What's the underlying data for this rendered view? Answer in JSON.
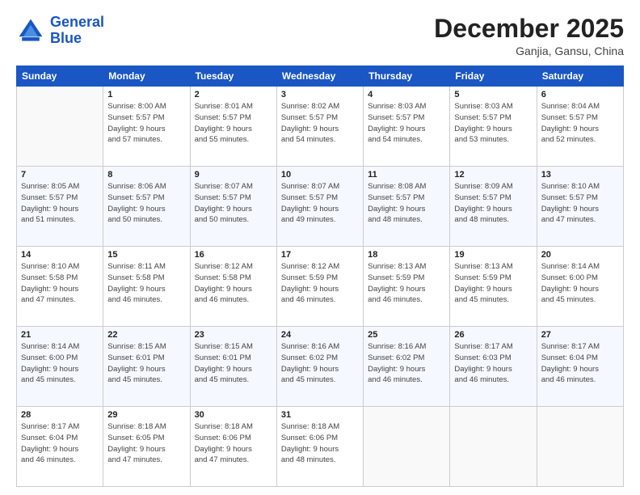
{
  "header": {
    "logo_line1": "General",
    "logo_line2": "Blue",
    "month_title": "December 2025",
    "subtitle": "Ganjia, Gansu, China"
  },
  "days_of_week": [
    "Sunday",
    "Monday",
    "Tuesday",
    "Wednesday",
    "Thursday",
    "Friday",
    "Saturday"
  ],
  "weeks": [
    [
      {
        "day": "",
        "info": ""
      },
      {
        "day": "1",
        "info": "Sunrise: 8:00 AM\nSunset: 5:57 PM\nDaylight: 9 hours\nand 57 minutes."
      },
      {
        "day": "2",
        "info": "Sunrise: 8:01 AM\nSunset: 5:57 PM\nDaylight: 9 hours\nand 55 minutes."
      },
      {
        "day": "3",
        "info": "Sunrise: 8:02 AM\nSunset: 5:57 PM\nDaylight: 9 hours\nand 54 minutes."
      },
      {
        "day": "4",
        "info": "Sunrise: 8:03 AM\nSunset: 5:57 PM\nDaylight: 9 hours\nand 54 minutes."
      },
      {
        "day": "5",
        "info": "Sunrise: 8:03 AM\nSunset: 5:57 PM\nDaylight: 9 hours\nand 53 minutes."
      },
      {
        "day": "6",
        "info": "Sunrise: 8:04 AM\nSunset: 5:57 PM\nDaylight: 9 hours\nand 52 minutes."
      }
    ],
    [
      {
        "day": "7",
        "info": "Sunrise: 8:05 AM\nSunset: 5:57 PM\nDaylight: 9 hours\nand 51 minutes."
      },
      {
        "day": "8",
        "info": "Sunrise: 8:06 AM\nSunset: 5:57 PM\nDaylight: 9 hours\nand 50 minutes."
      },
      {
        "day": "9",
        "info": "Sunrise: 8:07 AM\nSunset: 5:57 PM\nDaylight: 9 hours\nand 50 minutes."
      },
      {
        "day": "10",
        "info": "Sunrise: 8:07 AM\nSunset: 5:57 PM\nDaylight: 9 hours\nand 49 minutes."
      },
      {
        "day": "11",
        "info": "Sunrise: 8:08 AM\nSunset: 5:57 PM\nDaylight: 9 hours\nand 48 minutes."
      },
      {
        "day": "12",
        "info": "Sunrise: 8:09 AM\nSunset: 5:57 PM\nDaylight: 9 hours\nand 48 minutes."
      },
      {
        "day": "13",
        "info": "Sunrise: 8:10 AM\nSunset: 5:57 PM\nDaylight: 9 hours\nand 47 minutes."
      }
    ],
    [
      {
        "day": "14",
        "info": "Sunrise: 8:10 AM\nSunset: 5:58 PM\nDaylight: 9 hours\nand 47 minutes."
      },
      {
        "day": "15",
        "info": "Sunrise: 8:11 AM\nSunset: 5:58 PM\nDaylight: 9 hours\nand 46 minutes."
      },
      {
        "day": "16",
        "info": "Sunrise: 8:12 AM\nSunset: 5:58 PM\nDaylight: 9 hours\nand 46 minutes."
      },
      {
        "day": "17",
        "info": "Sunrise: 8:12 AM\nSunset: 5:59 PM\nDaylight: 9 hours\nand 46 minutes."
      },
      {
        "day": "18",
        "info": "Sunrise: 8:13 AM\nSunset: 5:59 PM\nDaylight: 9 hours\nand 46 minutes."
      },
      {
        "day": "19",
        "info": "Sunrise: 8:13 AM\nSunset: 5:59 PM\nDaylight: 9 hours\nand 45 minutes."
      },
      {
        "day": "20",
        "info": "Sunrise: 8:14 AM\nSunset: 6:00 PM\nDaylight: 9 hours\nand 45 minutes."
      }
    ],
    [
      {
        "day": "21",
        "info": "Sunrise: 8:14 AM\nSunset: 6:00 PM\nDaylight: 9 hours\nand 45 minutes."
      },
      {
        "day": "22",
        "info": "Sunrise: 8:15 AM\nSunset: 6:01 PM\nDaylight: 9 hours\nand 45 minutes."
      },
      {
        "day": "23",
        "info": "Sunrise: 8:15 AM\nSunset: 6:01 PM\nDaylight: 9 hours\nand 45 minutes."
      },
      {
        "day": "24",
        "info": "Sunrise: 8:16 AM\nSunset: 6:02 PM\nDaylight: 9 hours\nand 45 minutes."
      },
      {
        "day": "25",
        "info": "Sunrise: 8:16 AM\nSunset: 6:02 PM\nDaylight: 9 hours\nand 46 minutes."
      },
      {
        "day": "26",
        "info": "Sunrise: 8:17 AM\nSunset: 6:03 PM\nDaylight: 9 hours\nand 46 minutes."
      },
      {
        "day": "27",
        "info": "Sunrise: 8:17 AM\nSunset: 6:04 PM\nDaylight: 9 hours\nand 46 minutes."
      }
    ],
    [
      {
        "day": "28",
        "info": "Sunrise: 8:17 AM\nSunset: 6:04 PM\nDaylight: 9 hours\nand 46 minutes."
      },
      {
        "day": "29",
        "info": "Sunrise: 8:18 AM\nSunset: 6:05 PM\nDaylight: 9 hours\nand 47 minutes."
      },
      {
        "day": "30",
        "info": "Sunrise: 8:18 AM\nSunset: 6:06 PM\nDaylight: 9 hours\nand 47 minutes."
      },
      {
        "day": "31",
        "info": "Sunrise: 8:18 AM\nSunset: 6:06 PM\nDaylight: 9 hours\nand 48 minutes."
      },
      {
        "day": "",
        "info": ""
      },
      {
        "day": "",
        "info": ""
      },
      {
        "day": "",
        "info": ""
      }
    ]
  ]
}
